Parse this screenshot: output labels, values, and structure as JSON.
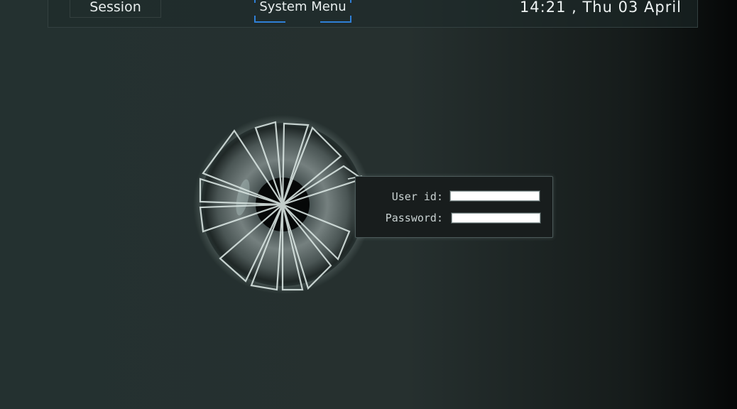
{
  "header": {
    "session_label": "Session",
    "system_menu_label": "System Menu",
    "clock_text": "14:21 , Thu 03 April"
  },
  "login": {
    "user_label": "User id:",
    "password_label": "Password:",
    "user_value": "",
    "password_value": ""
  },
  "colors": {
    "background": "#243130",
    "accent_bracket": "#2f7fd6",
    "panel": "#181d1d"
  },
  "icons": {
    "logo": "iris-eye-icon"
  }
}
